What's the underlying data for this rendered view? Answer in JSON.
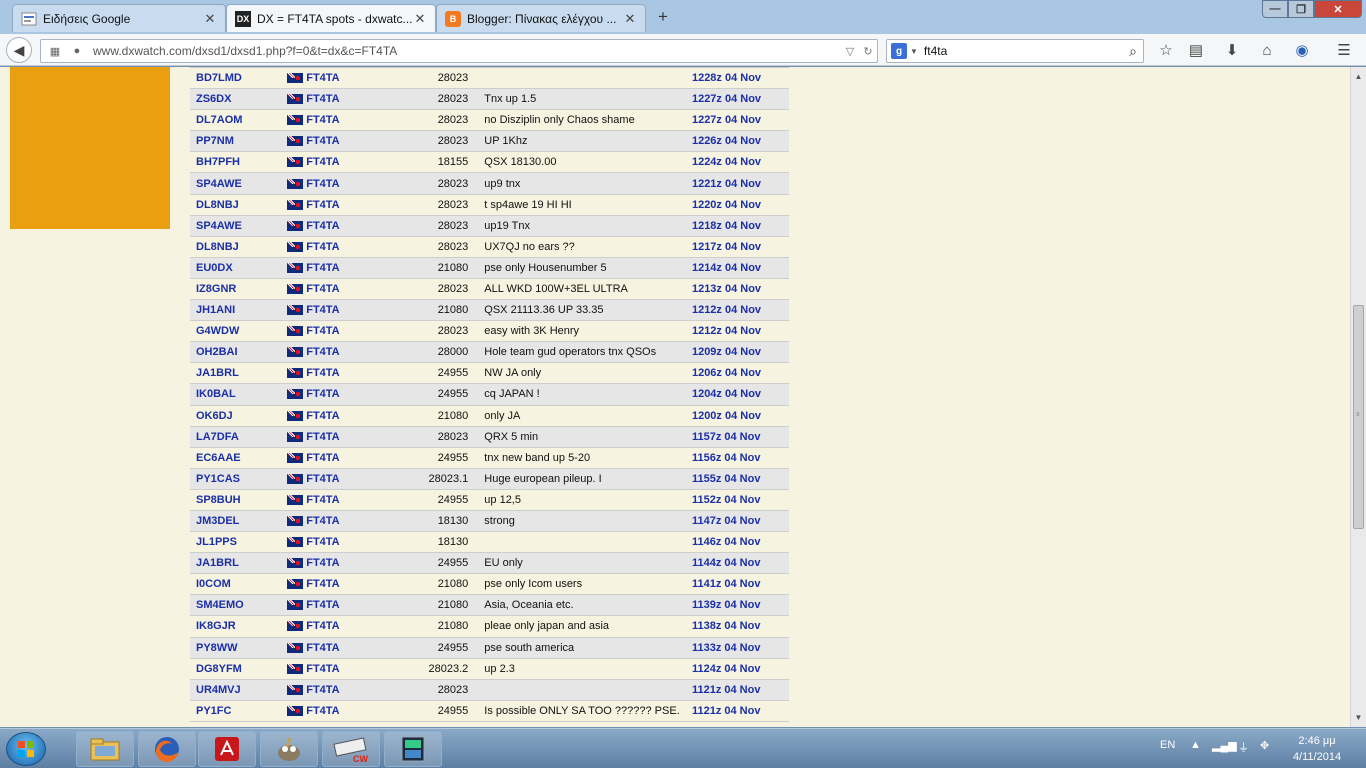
{
  "browser": {
    "tabs": [
      {
        "title": "Ειδήσεις Google",
        "favicon": "google-news-icon",
        "active": false
      },
      {
        "title": "DX = FT4TA spots - dxwatc...",
        "favicon": "dx-icon",
        "favicon_text": "DX",
        "active": true
      },
      {
        "title": "Blogger: Πίνακας ελέγχου ...",
        "favicon": "blogger-icon",
        "active": false
      }
    ],
    "url": "www.dxwatch.com/dxsd1/dxsd1.php?f=0&t=dx&c=FT4TA",
    "search": {
      "engine_letter": "g",
      "value": "ft4ta"
    }
  },
  "spots": [
    {
      "spotter": "BD7LMD",
      "dx": "FT4TA",
      "freq": "28023",
      "comment": "",
      "time": "1228z 04 Nov"
    },
    {
      "spotter": "ZS6DX",
      "dx": "FT4TA",
      "freq": "28023",
      "comment": "Tnx up 1.5",
      "time": "1227z 04 Nov"
    },
    {
      "spotter": "DL7AOM",
      "dx": "FT4TA",
      "freq": "28023",
      "comment": "no Disziplin only Chaos shame",
      "time": "1227z 04 Nov"
    },
    {
      "spotter": "PP7NM",
      "dx": "FT4TA",
      "freq": "28023",
      "comment": "UP 1Khz",
      "time": "1226z 04 Nov"
    },
    {
      "spotter": "BH7PFH",
      "dx": "FT4TA",
      "freq": "18155",
      "comment": "QSX 18130.00",
      "time": "1224z 04 Nov"
    },
    {
      "spotter": "SP4AWE",
      "dx": "FT4TA",
      "freq": "28023",
      "comment": "up9 tnx",
      "time": "1221z 04 Nov"
    },
    {
      "spotter": "DL8NBJ",
      "dx": "FT4TA",
      "freq": "28023",
      "comment": "t sp4awe 19 HI HI",
      "time": "1220z 04 Nov"
    },
    {
      "spotter": "SP4AWE",
      "dx": "FT4TA",
      "freq": "28023",
      "comment": "up19 Tnx",
      "time": "1218z 04 Nov"
    },
    {
      "spotter": "DL8NBJ",
      "dx": "FT4TA",
      "freq": "28023",
      "comment": "UX7QJ no ears ??",
      "time": "1217z 04 Nov"
    },
    {
      "spotter": "EU0DX",
      "dx": "FT4TA",
      "freq": "21080",
      "comment": "pse only Housenumber 5",
      "time": "1214z 04 Nov"
    },
    {
      "spotter": "IZ8GNR",
      "dx": "FT4TA",
      "freq": "28023",
      "comment": "ALL WKD 100W+3EL ULTRA",
      "time": "1213z 04 Nov"
    },
    {
      "spotter": "JH1ANI",
      "dx": "FT4TA",
      "freq": "21080",
      "comment": "QSX 21113.36 UP 33.35",
      "time": "1212z 04 Nov"
    },
    {
      "spotter": "G4WDW",
      "dx": "FT4TA",
      "freq": "28023",
      "comment": "easy with 3K Henry",
      "time": "1212z 04 Nov"
    },
    {
      "spotter": "OH2BAI",
      "dx": "FT4TA",
      "freq": "28000",
      "comment": "Hole team gud operators tnx QSOs",
      "time": "1209z 04 Nov"
    },
    {
      "spotter": "JA1BRL",
      "dx": "FT4TA",
      "freq": "24955",
      "comment": "NW JA only",
      "time": "1206z 04 Nov"
    },
    {
      "spotter": "IK0BAL",
      "dx": "FT4TA",
      "freq": "24955",
      "comment": "cq JAPAN !",
      "time": "1204z 04 Nov"
    },
    {
      "spotter": "OK6DJ",
      "dx": "FT4TA",
      "freq": "21080",
      "comment": "only JA",
      "time": "1200z 04 Nov"
    },
    {
      "spotter": "LA7DFA",
      "dx": "FT4TA",
      "freq": "28023",
      "comment": "QRX 5 min",
      "time": "1157z 04 Nov"
    },
    {
      "spotter": "EC6AAE",
      "dx": "FT4TA",
      "freq": "24955",
      "comment": "tnx new band up 5-20",
      "time": "1156z 04 Nov"
    },
    {
      "spotter": "PY1CAS",
      "dx": "FT4TA",
      "freq": "28023.1",
      "comment": "Huge european pileup. I",
      "time": "1155z 04 Nov"
    },
    {
      "spotter": "SP8BUH",
      "dx": "FT4TA",
      "freq": "24955",
      "comment": "up 12,5",
      "time": "1152z 04 Nov"
    },
    {
      "spotter": "JM3DEL",
      "dx": "FT4TA",
      "freq": "18130",
      "comment": "strong",
      "time": "1147z 04 Nov"
    },
    {
      "spotter": "JL1PPS",
      "dx": "FT4TA",
      "freq": "18130",
      "comment": "",
      "time": "1146z 04 Nov"
    },
    {
      "spotter": "JA1BRL",
      "dx": "FT4TA",
      "freq": "24955",
      "comment": "EU only",
      "time": "1144z 04 Nov"
    },
    {
      "spotter": "I0COM",
      "dx": "FT4TA",
      "freq": "21080",
      "comment": "pse only Icom users",
      "time": "1141z 04 Nov"
    },
    {
      "spotter": "SM4EMO",
      "dx": "FT4TA",
      "freq": "21080",
      "comment": "Asia, Oceania etc.",
      "time": "1139z 04 Nov"
    },
    {
      "spotter": "IK8GJR",
      "dx": "FT4TA",
      "freq": "21080",
      "comment": "pleae only japan and asia",
      "time": "1138z 04 Nov"
    },
    {
      "spotter": "PY8WW",
      "dx": "FT4TA",
      "freq": "24955",
      "comment": "pse south america",
      "time": "1133z 04 Nov"
    },
    {
      "spotter": "DG8YFM",
      "dx": "FT4TA",
      "freq": "28023.2",
      "comment": "up 2.3",
      "time": "1124z 04 Nov"
    },
    {
      "spotter": "UR4MVJ",
      "dx": "FT4TA",
      "freq": "28023",
      "comment": "",
      "time": "1121z 04 Nov"
    },
    {
      "spotter": "PY1FC",
      "dx": "FT4TA",
      "freq": "24955",
      "comment": "Is possible ONLY SA TOO ?????? PSE.",
      "time": "1121z 04 Nov"
    }
  ],
  "taskbar": {
    "language": "EN",
    "time": "2:46 μμ",
    "date": "4/11/2014",
    "apps": [
      "explorer-folder-icon",
      "firefox-icon",
      "acrobat-icon",
      "gimp-icon",
      "cw-keyboard-icon",
      "terminal-app-icon"
    ]
  },
  "colors": {
    "page_bg": "#f6f4e0",
    "link_blue": "#1b2fa6",
    "orange_box": "#e99f0f",
    "row_alt": "#e6e6e6"
  }
}
